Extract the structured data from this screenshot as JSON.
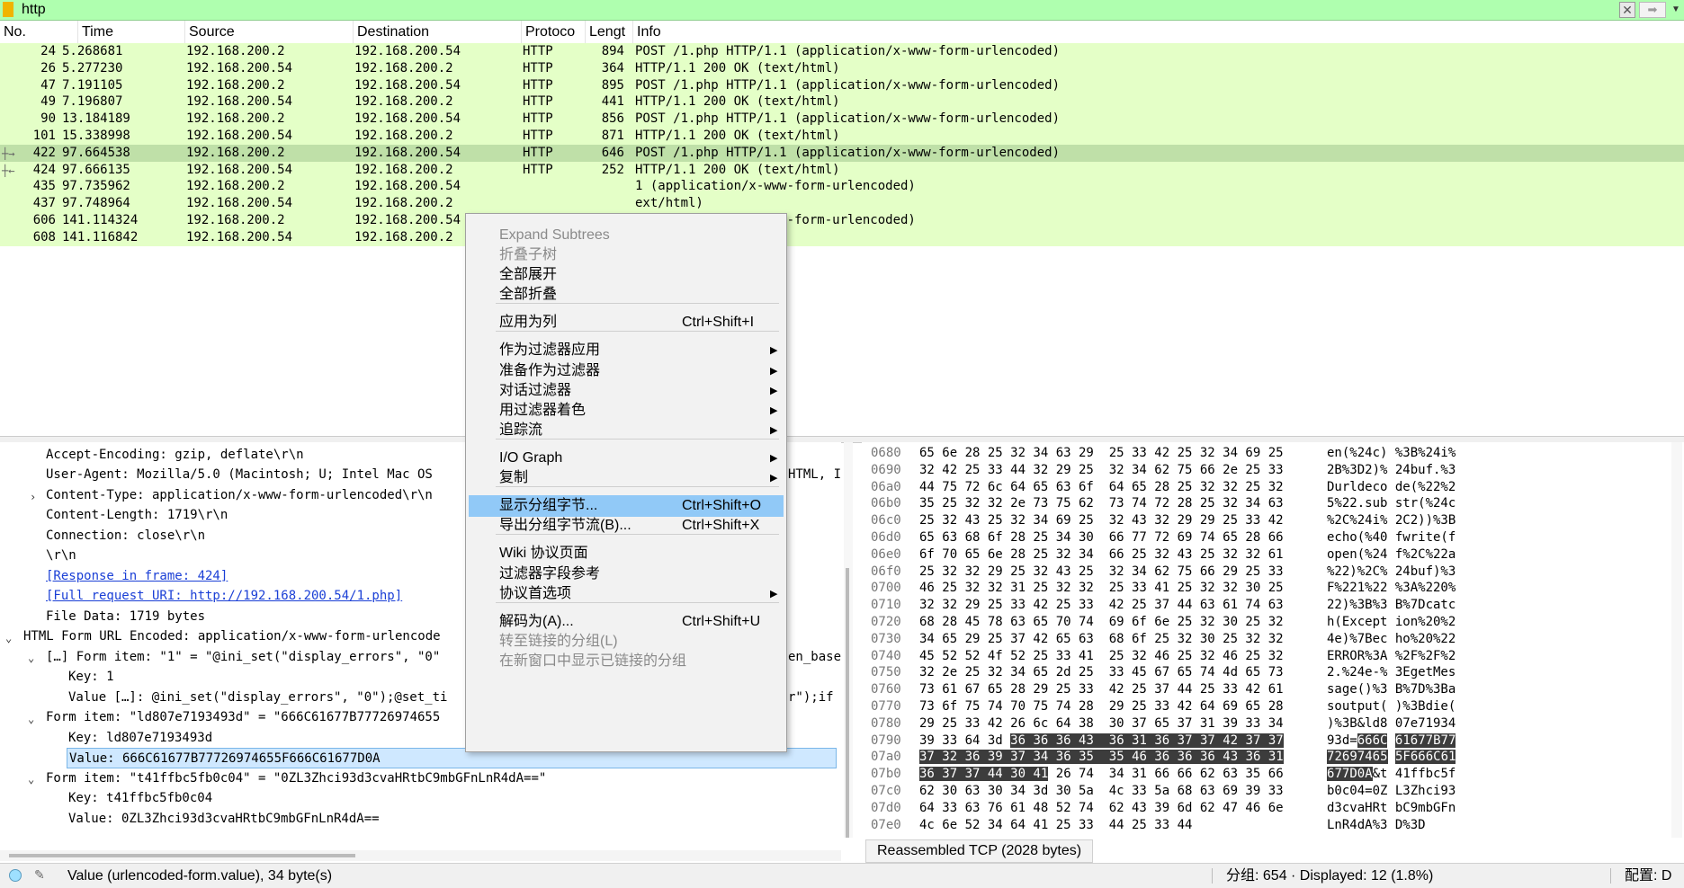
{
  "filter": {
    "text": "http"
  },
  "columns": [
    "No.",
    "Time",
    "Source",
    "Destination",
    "Protoco",
    "Lengt",
    "Info"
  ],
  "packets": [
    {
      "no": "24",
      "time": "5.268681",
      "src": "192.168.200.2",
      "dst": "192.168.200.54",
      "proto": "HTTP",
      "len": "894",
      "info": "POST /1.php HTTP/1.1  (application/x-www-form-urlencoded)"
    },
    {
      "no": "26",
      "time": "5.277230",
      "src": "192.168.200.54",
      "dst": "192.168.200.2",
      "proto": "HTTP",
      "len": "364",
      "info": "HTTP/1.1 200 OK  (text/html)"
    },
    {
      "no": "47",
      "time": "7.191105",
      "src": "192.168.200.2",
      "dst": "192.168.200.54",
      "proto": "HTTP",
      "len": "895",
      "info": "POST /1.php HTTP/1.1  (application/x-www-form-urlencoded)"
    },
    {
      "no": "49",
      "time": "7.196807",
      "src": "192.168.200.54",
      "dst": "192.168.200.2",
      "proto": "HTTP",
      "len": "441",
      "info": "HTTP/1.1 200 OK  (text/html)"
    },
    {
      "no": "90",
      "time": "13.184189",
      "src": "192.168.200.2",
      "dst": "192.168.200.54",
      "proto": "HTTP",
      "len": "856",
      "info": "POST /1.php HTTP/1.1  (application/x-www-form-urlencoded)"
    },
    {
      "no": "101",
      "time": "15.338998",
      "src": "192.168.200.54",
      "dst": "192.168.200.2",
      "proto": "HTTP",
      "len": "871",
      "info": "HTTP/1.1 200 OK  (text/html)"
    },
    {
      "no": "422",
      "time": "97.664538",
      "src": "192.168.200.2",
      "dst": "192.168.200.54",
      "proto": "HTTP",
      "len": "646",
      "info": "POST /1.php HTTP/1.1  (application/x-www-form-urlencoded)"
    },
    {
      "no": "424",
      "time": "97.666135",
      "src": "192.168.200.54",
      "dst": "192.168.200.2",
      "proto": "HTTP",
      "len": "252",
      "info": "HTTP/1.1 200 OK  (text/html)"
    },
    {
      "no": "435",
      "time": "97.735962",
      "src": "192.168.200.2",
      "dst": "192.168.200.54",
      "proto": "",
      "len": "",
      "info": "1  (application/x-www-form-urlencoded)"
    },
    {
      "no": "437",
      "time": "97.748964",
      "src": "192.168.200.54",
      "dst": "192.168.200.2",
      "proto": "",
      "len": "",
      "info": "ext/html)"
    },
    {
      "no": "606",
      "time": "141.114324",
      "src": "192.168.200.2",
      "dst": "192.168.200.54",
      "proto": "",
      "len": "",
      "info": "1  (application/x-www-form-urlencoded)"
    },
    {
      "no": "608",
      "time": "141.116842",
      "src": "192.168.200.54",
      "dst": "192.168.200.2",
      "proto": "",
      "len": "",
      "info": "ext/html)"
    }
  ],
  "details": {
    "lines": [
      "Accept-Encoding: gzip, deflate\\r\\n",
      "User-Agent: Mozilla/5.0 (Macintosh; U; Intel Mac OS",
      "Content-Type: application/x-www-form-urlencoded\\r\\n",
      "Content-Length: 1719\\r\\n",
      "Connection: close\\r\\n",
      "\\r\\n",
      "[Response in frame: 424]",
      "[Full request URI: http://192.168.200.54/1.php]",
      "File Data: 1719 bytes",
      "HTML Form URL Encoded: application/x-www-form-urlencode",
      "[…] Form item: \"1\" = \"@ini_set(\"display_errors\", \"0\"",
      "Key: 1",
      "Value […]: @ini_set(\"display_errors\", \"0\");@set_ti",
      "Form item: \"ld807e7193493d\" = \"666C61677B77726974655",
      "Key: ld807e7193493d",
      "Value: 666C61677B77726974655F666C61677D0A",
      "Form item: \"t41ffbc5fb0c04\" = \"0ZL3Zhci93d3cvaHRtbC9mbGFnLnR4dA==\"",
      "Key: t41ffbc5fb0c04",
      "Value: 0ZL3Zhci93d3cvaHRtbC9mbGFnLnR4dA=="
    ],
    "overflow_right": [
      "HTML, I",
      "en_base",
      "r\");if"
    ]
  },
  "bytes": {
    "rows": [
      {
        "off": "0680",
        "hex": "65 6e 28 25 32 34 63 29  25 33 42 25 32 34 69 25",
        "ascii": "en(%24c) %3B%24i%"
      },
      {
        "off": "0690",
        "hex": "32 42 25 33 44 32 29 25  32 34 62 75 66 2e 25 33",
        "ascii": "2B%3D2)% 24buf.%3"
      },
      {
        "off": "06a0",
        "hex": "44 75 72 6c 64 65 63 6f  64 65 28 25 32 32 25 32",
        "ascii": "Durldeco de(%22%2"
      },
      {
        "off": "06b0",
        "hex": "35 25 32 32 2e 73 75 62  73 74 72 28 25 32 34 63",
        "ascii": "5%22.sub str(%24c"
      },
      {
        "off": "06c0",
        "hex": "25 32 43 25 32 34 69 25  32 43 32 29 29 25 33 42",
        "ascii": "%2C%24i% 2C2))%3B"
      },
      {
        "off": "06d0",
        "hex": "65 63 68 6f 28 25 34 30  66 77 72 69 74 65 28 66",
        "ascii": "echo(%40 fwrite(f"
      },
      {
        "off": "06e0",
        "hex": "6f 70 65 6e 28 25 32 34  66 25 32 43 25 32 32 61",
        "ascii": "open(%24 f%2C%22a"
      },
      {
        "off": "06f0",
        "hex": "25 32 32 29 25 32 43 25  32 34 62 75 66 29 25 33",
        "ascii": "%22)%2C% 24buf)%3"
      },
      {
        "off": "0700",
        "hex": "46 25 32 32 31 25 32 32  25 33 41 25 32 32 30 25",
        "ascii": "F%221%22 %3A%220%"
      },
      {
        "off": "0710",
        "hex": "32 32 29 25 33 42 25 33  42 25 37 44 63 61 74 63",
        "ascii": "22)%3B%3 B%7Dcatc"
      },
      {
        "off": "0720",
        "hex": "68 28 45 78 63 65 70 74  69 6f 6e 25 32 30 25 32",
        "ascii": "h(Except ion%20%2"
      },
      {
        "off": "0730",
        "hex": "34 65 29 25 37 42 65 63  68 6f 25 32 30 25 32 32",
        "ascii": "4e)%7Bec ho%20%22"
      },
      {
        "off": "0740",
        "hex": "45 52 52 4f 52 25 33 41  25 32 46 25 32 46 25 32",
        "ascii": "ERROR%3A %2F%2F%2"
      },
      {
        "off": "0750",
        "hex": "32 2e 25 32 34 65 2d 25  33 45 67 65 74 4d 65 73",
        "ascii": "2.%24e-% 3EgetMes"
      },
      {
        "off": "0760",
        "hex": "73 61 67 65 28 29 25 33  42 25 37 44 25 33 42 61",
        "ascii": "sage()%3 B%7D%3Ba"
      },
      {
        "off": "0770",
        "hex": "73 6f 75 74 70 75 74 28  29 25 33 42 64 69 65 28",
        "ascii": "soutput( )%3Bdie("
      },
      {
        "off": "0780",
        "hex": "29 25 33 42 26 6c 64 38  30 37 65 37 31 39 33 34",
        "ascii": ")%3B&ld8 07e71934"
      },
      {
        "off": "0790",
        "hex": "39 33 64 3d 36 36 36 43  36 31 36 37 37 42 37 37",
        "ascii": "93d=666C 61677B77"
      },
      {
        "off": "07a0",
        "hex": "37 32 36 39 37 34 36 35  35 46 36 36 36 43 36 31",
        "ascii": "72697465 5F666C61"
      },
      {
        "off": "07b0",
        "hex": "36 37 37 44 30 41 26 74  34 31 66 66 62 63 35 66",
        "ascii": "677D0A&t 41ffbc5f"
      },
      {
        "off": "07c0",
        "hex": "62 30 63 30 34 3d 30 5a  4c 33 5a 68 63 69 39 33",
        "ascii": "b0c04=0Z L3Zhci93"
      },
      {
        "off": "07d0",
        "hex": "64 33 63 76 61 48 52 74  62 43 39 6d 62 47 46 6e",
        "ascii": "d3cvaHRt bC9mbGFn"
      },
      {
        "off": "07e0",
        "hex": "4c 6e 52 34 64 41 25 33  44 25 33 44",
        "ascii": "LnR4dA%3 D%3D"
      }
    ],
    "tab_label": "Reassembled TCP (2028 bytes)"
  },
  "status": {
    "field": "Value (urlencoded-form.value), 34 byte(s)",
    "packets": "分组: 654 · Displayed: 12 (1.8%)",
    "profile": "配置: D"
  },
  "menu": {
    "items": [
      {
        "label": "Expand Subtrees",
        "shortcut": "",
        "sub": false,
        "disabled": true
      },
      {
        "label": "折叠子树",
        "shortcut": "",
        "sub": false,
        "disabled": true
      },
      {
        "label": "全部展开",
        "shortcut": "",
        "sub": false,
        "disabled": false
      },
      {
        "label": "全部折叠",
        "shortcut": "",
        "sub": false,
        "disabled": false
      },
      {
        "label": "应用为列",
        "shortcut": "Ctrl+Shift+I",
        "sub": false,
        "disabled": false
      },
      {
        "label": "作为过滤器应用",
        "shortcut": "",
        "sub": true,
        "disabled": false
      },
      {
        "label": "准备作为过滤器",
        "shortcut": "",
        "sub": true,
        "disabled": false
      },
      {
        "label": "对话过滤器",
        "shortcut": "",
        "sub": true,
        "disabled": false
      },
      {
        "label": "用过滤器着色",
        "shortcut": "",
        "sub": true,
        "disabled": false
      },
      {
        "label": "追踪流",
        "shortcut": "",
        "sub": true,
        "disabled": false
      },
      {
        "label": "I/O Graph",
        "shortcut": "",
        "sub": true,
        "disabled": false
      },
      {
        "label": "复制",
        "shortcut": "",
        "sub": true,
        "disabled": false
      },
      {
        "label": "显示分组字节...",
        "shortcut": "Ctrl+Shift+O",
        "sub": false,
        "disabled": false
      },
      {
        "label": "导出分组字节流(B)...",
        "shortcut": "Ctrl+Shift+X",
        "sub": false,
        "disabled": false
      },
      {
        "label": "Wiki 协议页面",
        "shortcut": "",
        "sub": false,
        "disabled": false
      },
      {
        "label": "过滤器字段参考",
        "shortcut": "",
        "sub": false,
        "disabled": false
      },
      {
        "label": "协议首选项",
        "shortcut": "",
        "sub": true,
        "disabled": false
      },
      {
        "label": "解码为(A)...",
        "shortcut": "Ctrl+Shift+U",
        "sub": false,
        "disabled": false
      },
      {
        "label": "转至链接的分组(L)",
        "shortcut": "",
        "sub": false,
        "disabled": true
      },
      {
        "label": "在新窗口中显示已链接的分组",
        "shortcut": "",
        "sub": false,
        "disabled": true
      }
    ]
  }
}
